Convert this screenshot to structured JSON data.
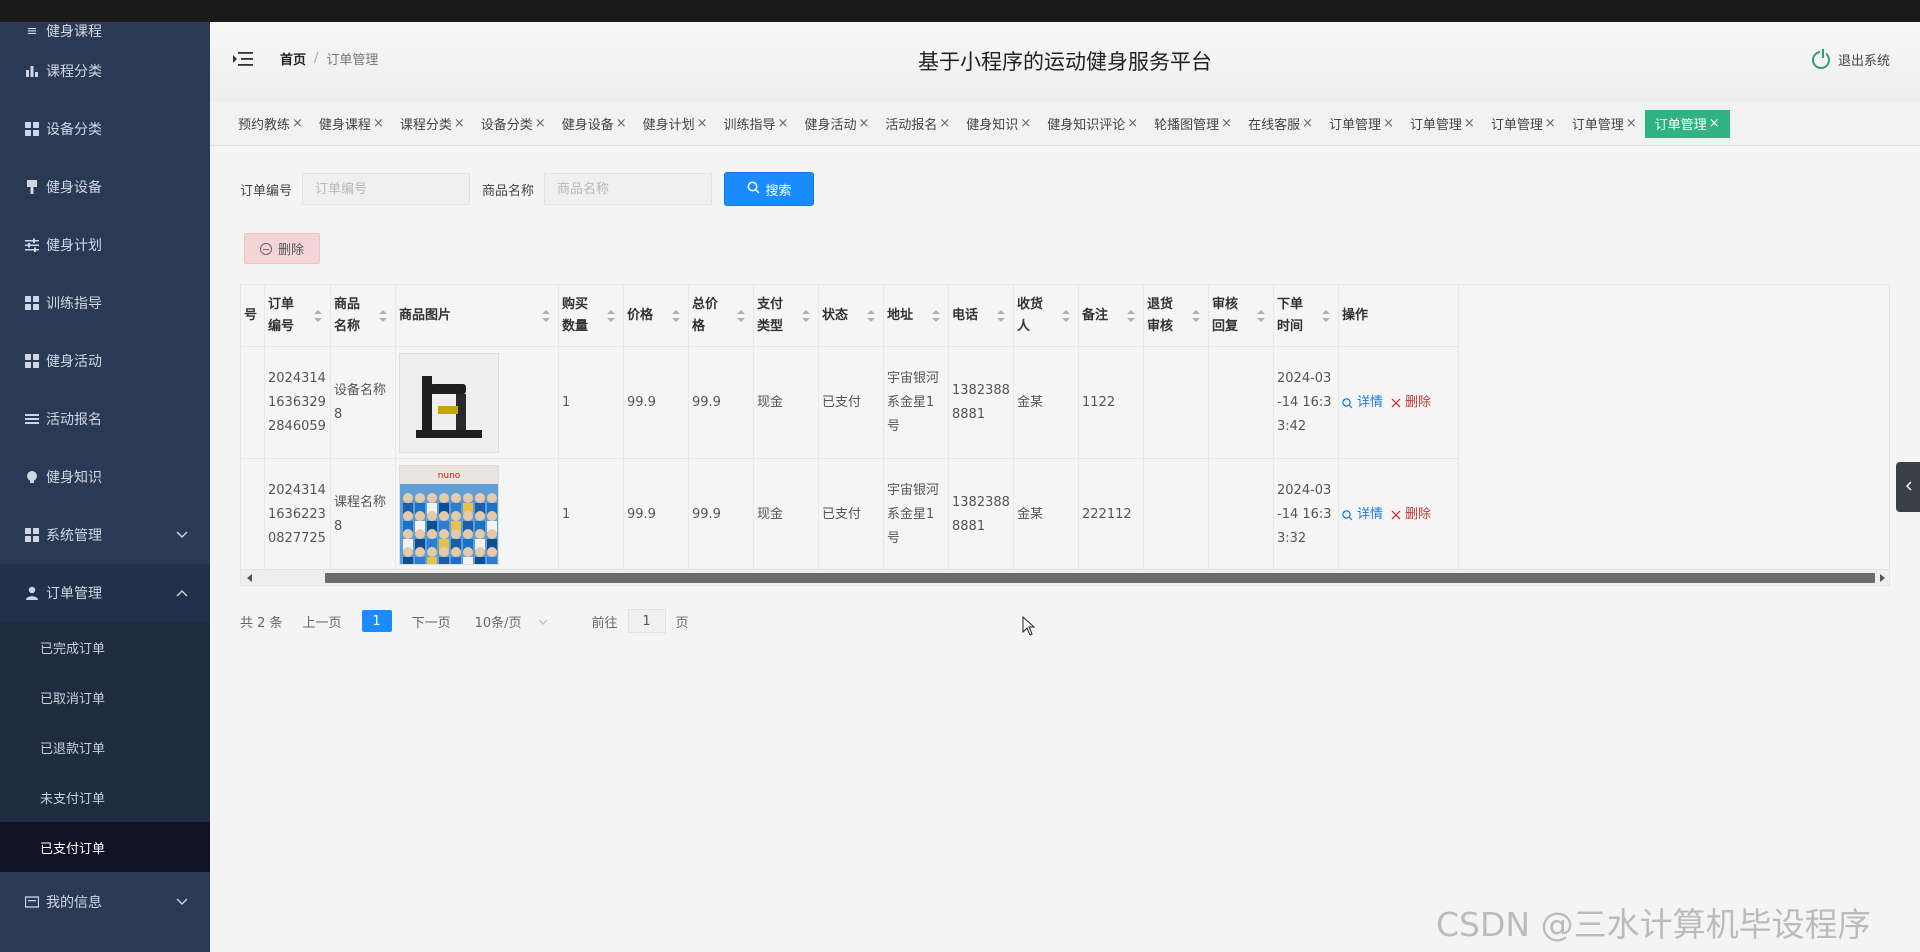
{
  "sidebar": {
    "top_cut_label": "健身课程",
    "items": [
      {
        "label": "课程分类",
        "icon": "bar-chart-icon"
      },
      {
        "label": "设备分类",
        "icon": "grid-icon"
      },
      {
        "label": "健身设备",
        "icon": "brush-icon"
      },
      {
        "label": "健身计划",
        "icon": "sliders-icon"
      },
      {
        "label": "训练指导",
        "icon": "grid-icon"
      },
      {
        "label": "健身活动",
        "icon": "grid-icon"
      },
      {
        "label": "活动报名",
        "icon": "list-icon"
      },
      {
        "label": "健身知识",
        "icon": "bulb-icon"
      },
      {
        "label": "系统管理",
        "icon": "grid-icon"
      },
      {
        "label": "订单管理",
        "icon": "user-icon"
      }
    ],
    "order_sub_items": [
      "已完成订单",
      "已取消订单",
      "已退款订单",
      "未支付订单",
      "已支付订单"
    ],
    "bottom_item": "我的信息"
  },
  "header": {
    "breadcrumb_home": "首页",
    "breadcrumb_sep": "/",
    "breadcrumb_current": "订单管理",
    "title": "基于小程序的运动健身服务平台",
    "logout": "退出系统"
  },
  "tabs": [
    "预约教练",
    "健身课程",
    "课程分类",
    "设备分类",
    "健身设备",
    "健身计划",
    "训练指导",
    "健身活动",
    "活动报名",
    "健身知识",
    "健身知识评论",
    "轮播图管理",
    "在线客服",
    "订单管理",
    "订单管理",
    "订单管理",
    "订单管理",
    "订单管理"
  ],
  "search": {
    "order_no_label": "订单编号",
    "order_no_placeholder": "订单编号",
    "product_label": "商品名称",
    "product_placeholder": "商品名称",
    "search_btn": "搜索"
  },
  "delete_btn": "删除",
  "table": {
    "headers": [
      "号",
      "订单编号",
      "商品名称",
      "商品图片",
      "购买数量",
      "价格",
      "总价格",
      "支付类型",
      "状态",
      "地址",
      "电话",
      "收货人",
      "备注",
      "退货审核",
      "审核回复",
      "下单时间",
      "操作"
    ],
    "rows": [
      {
        "order_no": "202431416363292846059",
        "product": "设备名称8",
        "image": "gym-machine-photo",
        "qty": "1",
        "price": "99.9",
        "total": "99.9",
        "pay": "现金",
        "status": "已支付",
        "address": "宇宙银河系金星1号",
        "phone": "13823888881",
        "receiver": "金某",
        "remark": "1122",
        "return_review": "",
        "review_reply": "",
        "time": "2024-03-14 16:33:42"
      },
      {
        "order_no": "202431416362230827725",
        "product": "课程名称8",
        "image": "group-photo",
        "qty": "1",
        "price": "99.9",
        "total": "99.9",
        "pay": "现金",
        "status": "已支付",
        "address": "宇宙银河系金星1号",
        "phone": "13823888881",
        "receiver": "金某",
        "remark": "222112",
        "return_review": "",
        "review_reply": "",
        "time": "2024-03-14 16:33:32"
      }
    ],
    "op_detail": "详情",
    "op_delete": "删除"
  },
  "pagination": {
    "total": "共 2 条",
    "prev": "上一页",
    "current": "1",
    "next": "下一页",
    "page_size": "10条/页",
    "goto": "前往",
    "goto_value": "1",
    "page_unit": "页"
  },
  "watermark": "CSDN @三水计算机毕设程序",
  "colors": {
    "sidebar": "#2a3a55",
    "active_tab": "#2fb47f",
    "primary": "#1a8cff",
    "danger": "#c13a3a"
  }
}
